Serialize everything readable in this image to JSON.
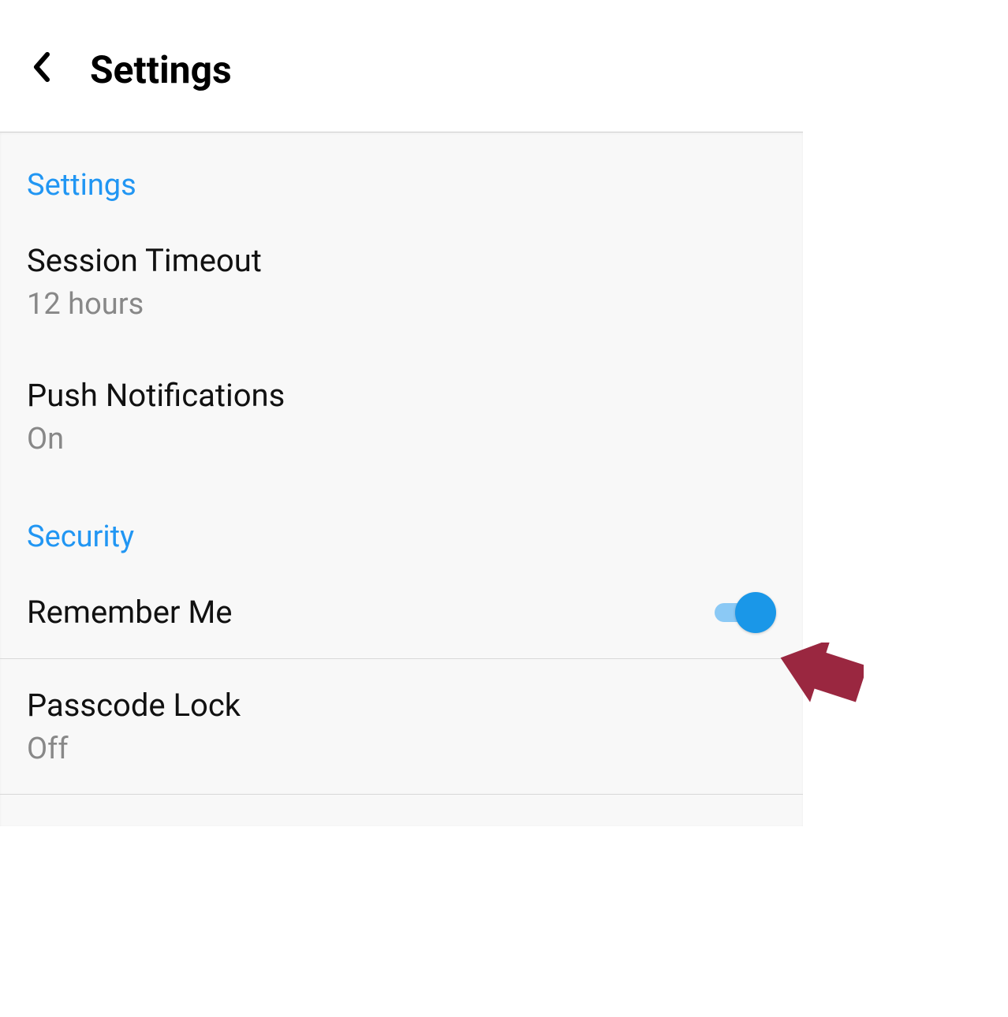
{
  "header": {
    "title": "Settings"
  },
  "sections": {
    "settings": {
      "header": "Settings",
      "items": {
        "sessionTimeout": {
          "label": "Session Timeout",
          "value": "12 hours"
        },
        "pushNotifications": {
          "label": "Push Notifications",
          "value": "On"
        }
      }
    },
    "security": {
      "header": "Security",
      "items": {
        "rememberMe": {
          "label": "Remember Me",
          "toggle": "on"
        },
        "passcodeLock": {
          "label": "Passcode Lock",
          "value": "Off"
        }
      }
    }
  },
  "colors": {
    "accent": "#2196f3",
    "toggleThumb": "#1a97e8",
    "toggleTrack": "#8bc9f5",
    "annotationArrow": "#9a2740"
  }
}
